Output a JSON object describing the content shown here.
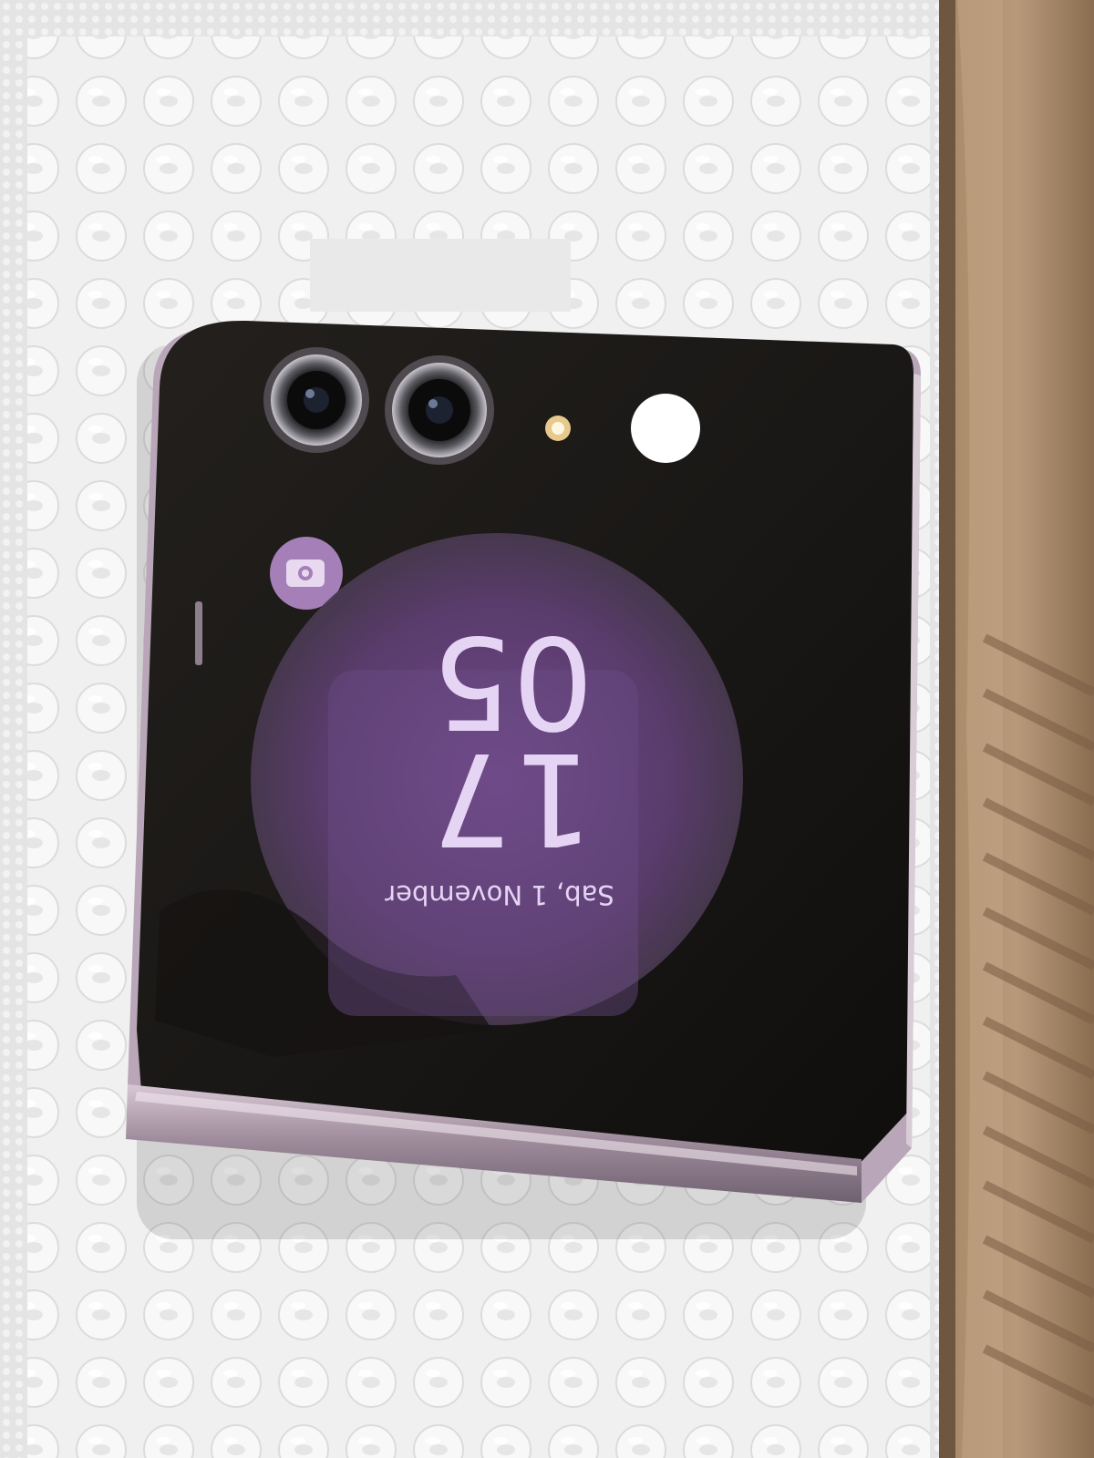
{
  "clock_widget": {
    "date": "Sab, 1 November",
    "hour": "17",
    "minute": "05"
  },
  "colors": {
    "accent_purple": "#b48ad0",
    "widget_text": "#e6d4f5",
    "frame_lavender": "#b9a6b8",
    "cover_glass": "#1b1917"
  },
  "icons": {
    "camera_shortcut": "camera-switch-icon"
  }
}
